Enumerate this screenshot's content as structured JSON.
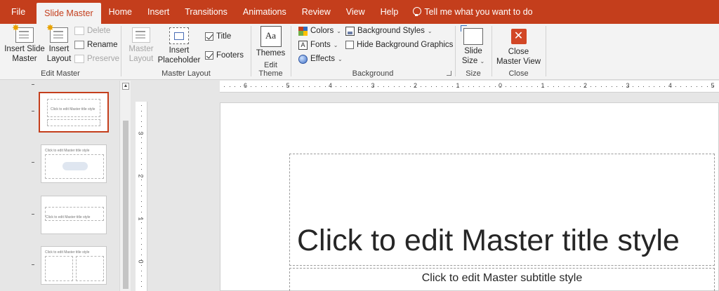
{
  "tabs": [
    {
      "label": "File",
      "active": false
    },
    {
      "label": "Slide Master",
      "active": true
    },
    {
      "label": "Home",
      "active": false
    },
    {
      "label": "Insert",
      "active": false
    },
    {
      "label": "Transitions",
      "active": false
    },
    {
      "label": "Animations",
      "active": false
    },
    {
      "label": "Review",
      "active": false
    },
    {
      "label": "View",
      "active": false
    },
    {
      "label": "Help",
      "active": false
    }
  ],
  "tell_me": "Tell me what you want to do",
  "ribbon": {
    "edit_master": {
      "label": "Edit Master",
      "insert_slide_master": [
        "Insert Slide",
        "Master"
      ],
      "insert_layout": [
        "Insert",
        "Layout"
      ],
      "delete": "Delete",
      "rename": "Rename",
      "preserve": "Preserve"
    },
    "master_layout": {
      "label": "Master Layout",
      "master_layout_btn": [
        "Master",
        "Layout"
      ],
      "insert_placeholder": [
        "Insert",
        "Placeholder"
      ],
      "title": "Title",
      "title_checked": true,
      "footers": "Footers",
      "footers_checked": true
    },
    "edit_theme": {
      "label": "Edit Theme",
      "themes": "Themes",
      "themes_icon_text": "Aa"
    },
    "background": {
      "label": "Background",
      "colors": "Colors",
      "fonts": "Fonts",
      "fonts_icon_text": "A",
      "effects": "Effects",
      "background_styles": "Background Styles",
      "hide_background_graphics": "Hide Background Graphics",
      "hide_checked": false
    },
    "size": {
      "label": "Size",
      "slide_size": [
        "Slide",
        "Size"
      ]
    },
    "close": {
      "label": "Close",
      "close_master_view": [
        "Close",
        "Master View"
      ],
      "close_icon": "✕"
    }
  },
  "thumbnails": [
    {
      "kind": "master",
      "title": "Click to edit Master title style"
    },
    {
      "kind": "layout",
      "title": "Click to edit Master title style"
    },
    {
      "kind": "layout",
      "title": "Click to edit Master title style"
    },
    {
      "kind": "layout",
      "title": "Click to edit Master title style"
    }
  ],
  "hruler_numbers": [
    "6",
    "5",
    "4",
    "3",
    "2",
    "1",
    "0",
    "1",
    "2",
    "3",
    "4",
    "5"
  ],
  "vruler_numbers": [
    "3",
    "2",
    "1",
    "0"
  ],
  "slide": {
    "title": "Click to edit Master title style",
    "subtitle": "Click to edit Master subtitle style"
  },
  "colors": {
    "accent": "#c43e1c",
    "close_red": "#d24726"
  }
}
